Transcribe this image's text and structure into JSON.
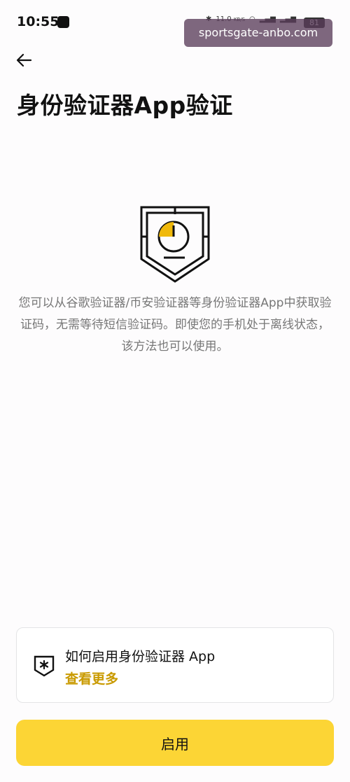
{
  "status_bar": {
    "time": "10:55",
    "net_speed": "11.0",
    "net_unit": "KB/S",
    "battery": "81",
    "icons": [
      "tiktok-icon",
      "bluetooth-icon",
      "wifi-icon",
      "signal-icon",
      "signal-icon"
    ]
  },
  "watermark": "sportsgate-anbo.com",
  "header": {
    "back_icon": "arrow-left-icon",
    "title": "身份验证器App验证"
  },
  "hero": {
    "icon": "shield-authenticator-icon",
    "accent_color": "#f0b90b"
  },
  "description": "您可以从谷歌验证器/币安验证器等身份验证器App中获取验证码，无需等待短信验证码。即使您的手机处于离线状态，该方法也可以使用。",
  "info_card": {
    "icon": "asterisk-shield-icon",
    "title": "如何启用身份验证器 App",
    "link": "查看更多",
    "link_color": "#c99a00"
  },
  "primary_button": {
    "label": "启用",
    "color": "#fcd535"
  }
}
